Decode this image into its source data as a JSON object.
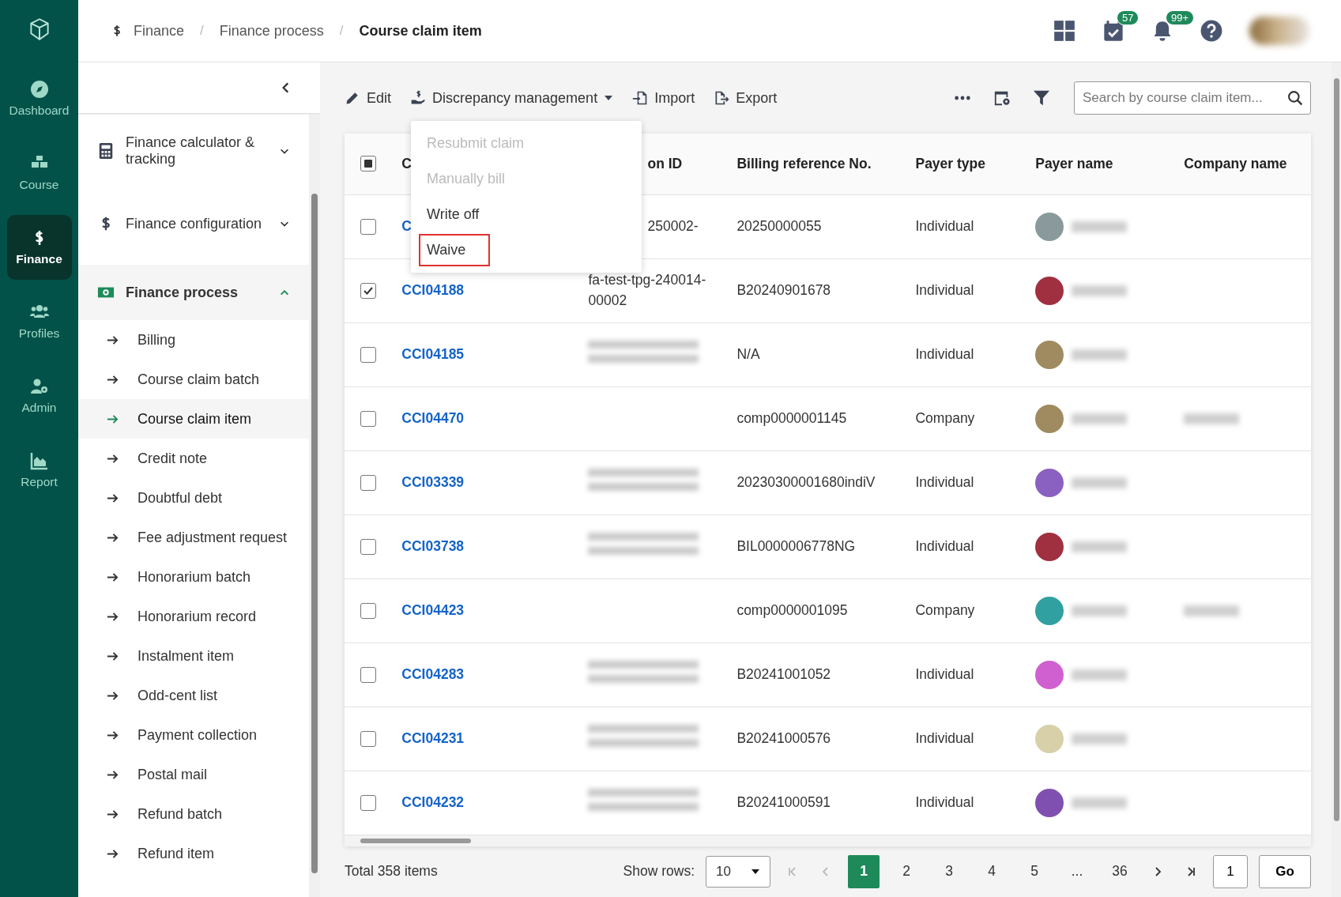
{
  "rail": {
    "items": [
      {
        "label": "Dashboard",
        "selected": false
      },
      {
        "label": "Course",
        "selected": false
      },
      {
        "label": "Finance",
        "selected": true
      },
      {
        "label": "Profiles",
        "selected": false
      },
      {
        "label": "Admin",
        "selected": false
      },
      {
        "label": "Report",
        "selected": false
      }
    ]
  },
  "breadcrumb": [
    "Finance",
    "Finance process",
    "Course claim item"
  ],
  "breadcrumb_separator": "/",
  "header": {
    "tasks_badge": "57",
    "notifications_badge": "99+"
  },
  "sidebar": {
    "groups": [
      {
        "label": "Finance calculator & tracking",
        "expanded": false
      },
      {
        "label": "Finance configuration",
        "expanded": false
      },
      {
        "label": "Finance process",
        "expanded": true,
        "children": [
          {
            "label": "Billing",
            "selected": false
          },
          {
            "label": "Course claim batch",
            "selected": false
          },
          {
            "label": "Course claim item",
            "selected": true
          },
          {
            "label": "Credit note",
            "selected": false
          },
          {
            "label": "Doubtful debt",
            "selected": false
          },
          {
            "label": "Fee adjustment request",
            "selected": false
          },
          {
            "label": "Honorarium batch",
            "selected": false
          },
          {
            "label": "Honorarium record",
            "selected": false
          },
          {
            "label": "Instalment item",
            "selected": false
          },
          {
            "label": "Odd-cent list",
            "selected": false
          },
          {
            "label": "Payment collection",
            "selected": false
          },
          {
            "label": "Postal mail",
            "selected": false
          },
          {
            "label": "Refund batch",
            "selected": false
          },
          {
            "label": "Refund item",
            "selected": false
          }
        ]
      }
    ]
  },
  "toolbar": {
    "buttons": [
      "Edit",
      "Discrepancy management",
      "Import",
      "Export"
    ],
    "search": {
      "placeholder": "Search by course claim item..."
    }
  },
  "dropdown": {
    "items": [
      {
        "label": "Resubmit claim",
        "disabled": true,
        "highlighted": false
      },
      {
        "label": "Manually bill",
        "disabled": true,
        "highlighted": false
      },
      {
        "label": "Write off",
        "disabled": false,
        "highlighted": false
      },
      {
        "label": "Waive",
        "disabled": false,
        "highlighted": true
      }
    ]
  },
  "table": {
    "select_all_indeterminate": true,
    "columns": [
      "C",
      "on ID",
      "Billing reference No.",
      "Payer type",
      "Payer name",
      "Company name"
    ],
    "rows": [
      {
        "checked": false,
        "claim_item": "C",
        "run_id": "250002-",
        "run_id_redacted": false,
        "billing_ref": "20250000055",
        "payer_type": "Individual",
        "color": "#8a9a9c",
        "company_redacted": false
      },
      {
        "checked": true,
        "claim_item": "CCI04188",
        "run_id": "fa-test-tpg-240014-00002",
        "run_id_redacted": false,
        "billing_ref": "B20240901678",
        "payer_type": "Individual",
        "color": "#a03040",
        "company_redacted": false
      },
      {
        "checked": false,
        "claim_item": "CCI04185",
        "run_id_redacted": true,
        "billing_ref": "N/A",
        "payer_type": "Individual",
        "color": "#a08a60",
        "company_redacted": false
      },
      {
        "checked": false,
        "claim_item": "CCI04470",
        "run_id_redacted": false,
        "billing_ref": "comp0000001145",
        "payer_type": "Company",
        "color": "#a08a60",
        "company_redacted": true
      },
      {
        "checked": false,
        "claim_item": "CCI03339",
        "run_id_redacted": true,
        "billing_ref": "20230300001680indiV",
        "payer_type": "Individual",
        "color": "#8a60c0",
        "company_redacted": false
      },
      {
        "checked": false,
        "claim_item": "CCI03738",
        "run_id_redacted": true,
        "billing_ref": "BIL0000006778NG",
        "payer_type": "Individual",
        "color": "#a03040",
        "company_redacted": false
      },
      {
        "checked": false,
        "claim_item": "CCI04423",
        "run_id_redacted": false,
        "billing_ref": "comp0000001095",
        "payer_type": "Company",
        "color": "#30a0a0",
        "company_redacted": true
      },
      {
        "checked": false,
        "claim_item": "CCI04283",
        "run_id_redacted": true,
        "billing_ref": "B20241001052",
        "payer_type": "Individual",
        "color": "#d060d0",
        "company_redacted": false
      },
      {
        "checked": false,
        "claim_item": "CCI04231",
        "run_id_redacted": true,
        "billing_ref": "B20241000576",
        "payer_type": "Individual",
        "color": "#d8d0a8",
        "company_redacted": false
      },
      {
        "checked": false,
        "claim_item": "CCI04232",
        "run_id_redacted": true,
        "billing_ref": "B20241000591",
        "payer_type": "Individual",
        "color": "#8050b0",
        "company_redacted": false
      }
    ]
  },
  "footer": {
    "total": "Total 358 items",
    "show_rows_label": "Show rows:",
    "rows_per_page": "10",
    "pages": [
      {
        "label": "1",
        "selected": true
      },
      {
        "label": "2",
        "selected": false
      },
      {
        "label": "3",
        "selected": false
      },
      {
        "label": "4",
        "selected": false
      },
      {
        "label": "5",
        "selected": false
      },
      {
        "label": "...",
        "selected": false
      },
      {
        "label": "36",
        "selected": false
      }
    ],
    "first_disabled": true,
    "prev_disabled": true,
    "jump_value": "1",
    "go_label": "Go"
  }
}
